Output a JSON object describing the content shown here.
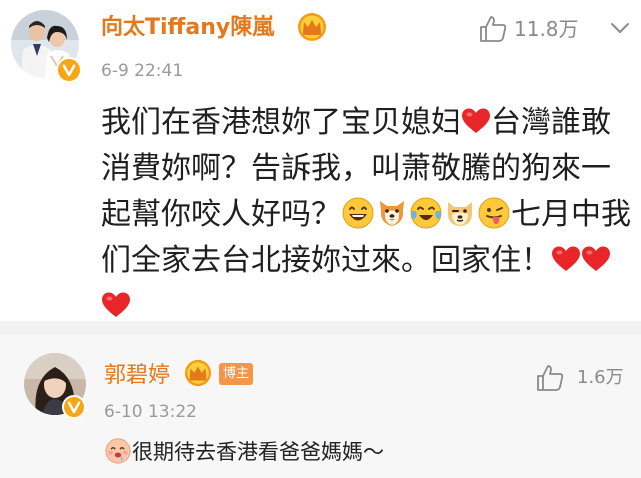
{
  "comments": [
    {
      "username": "向太Tiffany陳嵐",
      "timestamp": "6-9 22:41",
      "likes": "11.8万",
      "verified_icon": "verified-v-icon",
      "crown_icon": "vip-crown-icon",
      "body_lines": [
        [
          "我们在香港想妳了宝贝媳妇",
          "{heart}",
          "台灣誰敢"
        ],
        [
          "消費妳啊？告訴我，叫萧敬騰的狗來一"
        ],
        [
          "起幫你咬人好吗？",
          "{laugh}",
          "{dog}",
          "{tears}",
          "{doge}",
          "{tongue}",
          "七月中我"
        ],
        [
          "们全家去台北接妳过來。回家住！",
          "{heart}",
          "{heart}"
        ],
        [
          "{heart}"
        ]
      ],
      "colors": {
        "username": "#e5781b",
        "heart": "#e8262a"
      }
    },
    {
      "username": "郭碧婷",
      "timestamp": "6-10 13:22",
      "likes": "1.6万",
      "badge": "博主",
      "verified_icon": "verified-v-icon",
      "crown_icon": "vip-crown-icon",
      "body_lines": [
        [
          "{drool}",
          "很期待去香港看爸爸媽媽～"
        ]
      ],
      "colors": {
        "username": "#e5781b",
        "badge_bg": "#f4964a"
      }
    }
  ],
  "icons": {
    "like": "thumbs-up-outline-icon",
    "more": "chevron-down-icon"
  }
}
